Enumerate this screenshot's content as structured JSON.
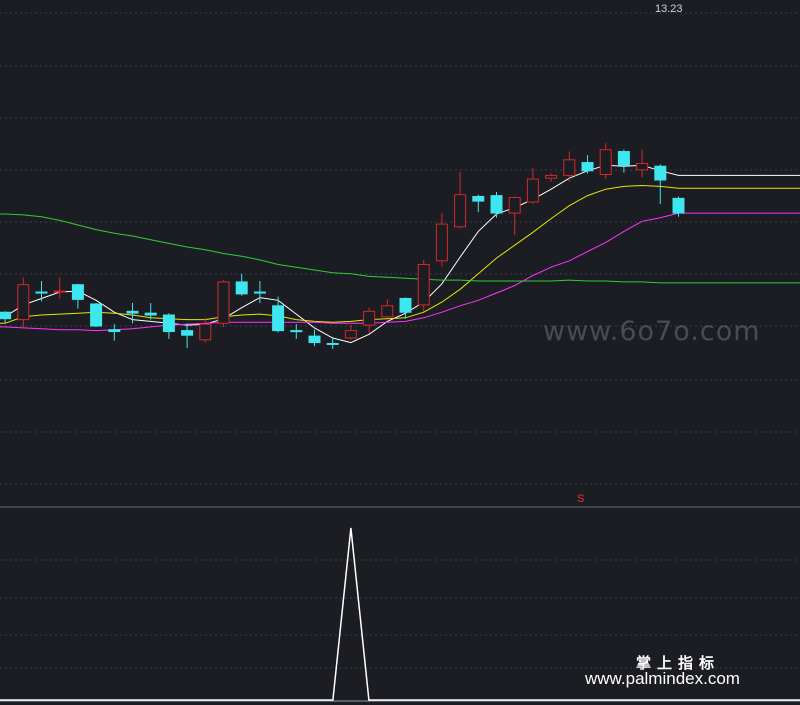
{
  "chart_data": [
    {
      "type": "candlestick",
      "panel": "main-price",
      "title": "",
      "annotations": {
        "high_label": "13.23"
      },
      "colors": {
        "up": "#d02a2a",
        "down": "#3ee7f0",
        "background": "#1b1d23",
        "grid": "#3a3d48"
      },
      "grid": true,
      "candles": [
        {
          "o": 9.9,
          "c": 9.83,
          "h": 9.91,
          "l": 9.78
        },
        {
          "o": 9.82,
          "c": 10.2,
          "h": 10.28,
          "l": 9.73
        },
        {
          "o": 10.12,
          "c": 10.11,
          "h": 10.24,
          "l": 10.02
        },
        {
          "o": 10.12,
          "c": 10.13,
          "h": 10.28,
          "l": 10.05
        },
        {
          "o": 10.2,
          "c": 10.04,
          "h": 10.21,
          "l": 9.94
        },
        {
          "o": 9.99,
          "c": 9.75,
          "h": 10.0,
          "l": 9.74
        },
        {
          "o": 9.71,
          "c": 9.69,
          "h": 9.77,
          "l": 9.59
        },
        {
          "o": 9.91,
          "c": 9.89,
          "h": 10.0,
          "l": 9.78
        },
        {
          "o": 9.89,
          "c": 9.87,
          "h": 10.0,
          "l": 9.82
        },
        {
          "o": 9.87,
          "c": 9.69,
          "h": 9.89,
          "l": 9.61
        },
        {
          "o": 9.7,
          "c": 9.65,
          "h": 9.78,
          "l": 9.51
        },
        {
          "o": 9.6,
          "c": 9.77,
          "h": 9.84,
          "l": 9.57
        },
        {
          "o": 9.78,
          "c": 10.23,
          "h": 10.25,
          "l": 9.74
        },
        {
          "o": 10.23,
          "c": 10.1,
          "h": 10.32,
          "l": 10.08
        },
        {
          "o": 10.12,
          "c": 10.12,
          "h": 10.24,
          "l": 10.0
        },
        {
          "o": 9.97,
          "c": 9.7,
          "h": 10.07,
          "l": 9.68
        },
        {
          "o": 9.7,
          "c": 9.69,
          "h": 9.77,
          "l": 9.61
        },
        {
          "o": 9.64,
          "c": 9.57,
          "h": 9.71,
          "l": 9.53
        },
        {
          "o": 9.56,
          "c": 9.56,
          "h": 9.63,
          "l": 9.5
        },
        {
          "o": 9.62,
          "c": 9.7,
          "h": 9.76,
          "l": 9.6
        },
        {
          "o": 9.76,
          "c": 9.91,
          "h": 9.95,
          "l": 9.67
        },
        {
          "o": 9.85,
          "c": 9.97,
          "h": 10.04,
          "l": 9.84
        },
        {
          "o": 10.05,
          "c": 9.9,
          "h": 10.06,
          "l": 9.83
        },
        {
          "o": 9.98,
          "c": 10.42,
          "h": 10.47,
          "l": 9.91
        },
        {
          "o": 10.46,
          "c": 10.86,
          "h": 10.98,
          "l": 10.4
        },
        {
          "o": 10.83,
          "c": 11.18,
          "h": 11.43,
          "l": 10.81
        },
        {
          "o": 11.16,
          "c": 11.11,
          "h": 11.18,
          "l": 10.99
        },
        {
          "o": 11.17,
          "c": 10.98,
          "h": 11.21,
          "l": 10.93
        },
        {
          "o": 10.98,
          "c": 11.15,
          "h": 11.16,
          "l": 10.74
        },
        {
          "o": 11.1,
          "c": 11.35,
          "h": 11.47,
          "l": 11.08
        },
        {
          "o": 11.36,
          "c": 11.39,
          "h": 11.41,
          "l": 11.32
        },
        {
          "o": 11.39,
          "c": 11.56,
          "h": 11.65,
          "l": 11.32
        },
        {
          "o": 11.53,
          "c": 11.44,
          "h": 11.61,
          "l": 11.41
        },
        {
          "o": 11.4,
          "c": 11.67,
          "h": 11.74,
          "l": 11.35
        },
        {
          "o": 11.65,
          "c": 11.5,
          "h": 11.67,
          "l": 11.42
        },
        {
          "o": 11.45,
          "c": 11.52,
          "h": 11.67,
          "l": 11.37
        },
        {
          "o": 11.49,
          "c": 11.34,
          "h": 11.51,
          "l": 11.08
        },
        {
          "o": 11.14,
          "c": 10.98,
          "h": 11.16,
          "l": 10.94
        }
      ],
      "ma_lines": [
        {
          "name": "MA5",
          "color": "#ffffff",
          "values": [
            9.85,
            9.98,
            10.05,
            10.12,
            10.13,
            10.03,
            9.9,
            9.82,
            9.8,
            9.78,
            9.76,
            9.77,
            9.83,
            9.95,
            10.06,
            10.03,
            9.88,
            9.73,
            9.62,
            9.57,
            9.66,
            9.8,
            9.89,
            10.01,
            10.21,
            10.5,
            10.78,
            10.97,
            11.04,
            11.13,
            11.24,
            11.36,
            11.44,
            11.5,
            11.49,
            11.5,
            11.44,
            11.39
          ]
        },
        {
          "name": "MA10",
          "color": "#e6e600",
          "values": [
            9.78,
            9.85,
            9.87,
            9.88,
            9.89,
            9.9,
            9.89,
            9.87,
            9.84,
            9.83,
            9.82,
            9.82,
            9.85,
            9.87,
            9.88,
            9.86,
            9.82,
            9.8,
            9.79,
            9.8,
            9.82,
            9.83,
            9.84,
            9.9,
            10.01,
            10.15,
            10.32,
            10.49,
            10.63,
            10.77,
            10.92,
            11.06,
            11.17,
            11.24,
            11.27,
            11.28,
            11.27,
            11.25
          ]
        },
        {
          "name": "MA30",
          "color": "#ff33ff",
          "values": [
            9.74,
            9.73,
            9.72,
            9.71,
            9.71,
            9.7,
            9.71,
            9.72,
            9.74,
            9.76,
            9.77,
            9.78,
            9.79,
            9.79,
            9.79,
            9.79,
            9.79,
            9.79,
            9.78,
            9.78,
            9.78,
            9.79,
            9.8,
            9.84,
            9.9,
            9.97,
            10.03,
            10.11,
            10.19,
            10.3,
            10.39,
            10.46,
            10.56,
            10.66,
            10.78,
            10.89,
            10.93,
            10.98
          ]
        },
        {
          "name": "MA60",
          "color": "#33cc33",
          "values": [
            10.97,
            10.96,
            10.94,
            10.9,
            10.85,
            10.8,
            10.76,
            10.73,
            10.69,
            10.65,
            10.61,
            10.58,
            10.54,
            10.51,
            10.47,
            10.42,
            10.39,
            10.36,
            10.33,
            10.32,
            10.29,
            10.28,
            10.27,
            10.26,
            10.25,
            10.25,
            10.24,
            10.24,
            10.24,
            10.24,
            10.24,
            10.25,
            10.24,
            10.24,
            10.23,
            10.23,
            10.22,
            10.22
          ]
        }
      ]
    },
    {
      "type": "line",
      "panel": "signal-indicator",
      "title": "",
      "signal_marker": "S",
      "series": [
        {
          "color": "#ffffff",
          "values": [
            0,
            0,
            0,
            0,
            0,
            0,
            0,
            0,
            0,
            0,
            0,
            0,
            0,
            0,
            0,
            0,
            0,
            0,
            0,
            1,
            0,
            0,
            0,
            0,
            0,
            0,
            0,
            0,
            0,
            0,
            0,
            0,
            0,
            0,
            0,
            0,
            0,
            0
          ]
        }
      ]
    }
  ],
  "watermarks": {
    "center": "www.6o7o.com",
    "bottom_cn": "掌上指标",
    "bottom_url": "www.palmindex.com"
  }
}
